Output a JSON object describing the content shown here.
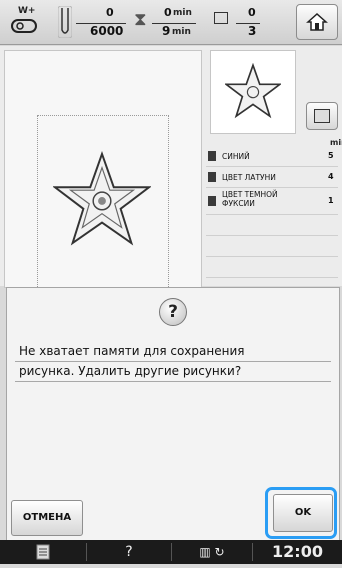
{
  "topbar": {
    "presser_foot_label": "W+",
    "stitch_current": "0",
    "stitch_total": "6000",
    "time_current": "0",
    "time_current_unit": "min",
    "time_total": "9",
    "time_total_unit": "min",
    "color_current": "0",
    "color_total": "3"
  },
  "color_list": {
    "header_unit": "min",
    "items": [
      {
        "name": "СИНИЙ",
        "minutes": "5"
      },
      {
        "name": "ЦВЕТ ЛАТУНИ",
        "minutes": "4"
      },
      {
        "name": "ЦВЕТ ТЕМНОЙ ФУКСИИ",
        "minutes": "1"
      }
    ]
  },
  "dialog": {
    "icon": "question-mark",
    "message_line1": "Не хватает памяти для сохранения",
    "message_line2": "рисунка. Удалить другие рисунки?",
    "cancel_label": "ОТМЕНА",
    "ok_label": "OK"
  },
  "bottombar": {
    "help_label": "?",
    "clock": "12:00"
  },
  "colors": {
    "highlight": "#2a9df4",
    "star_outline": "#333333"
  }
}
